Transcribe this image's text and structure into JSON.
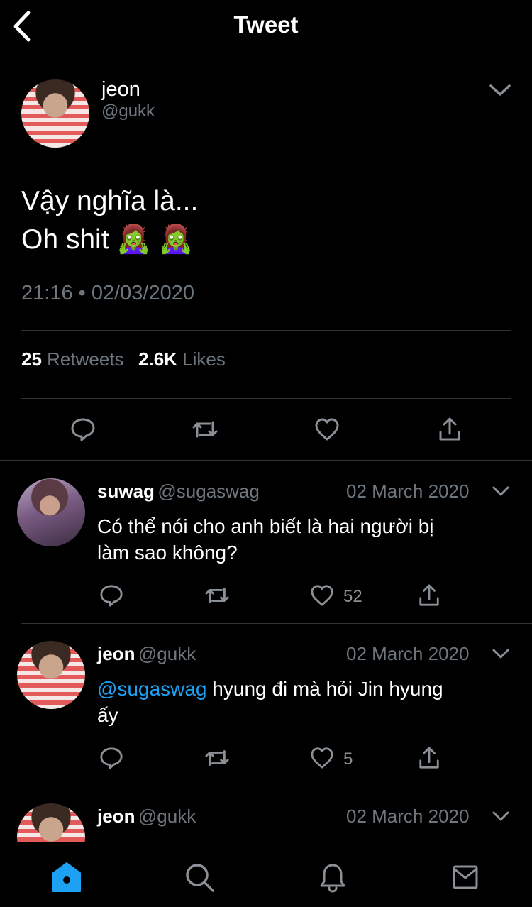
{
  "header": {
    "title": "Tweet"
  },
  "tweet": {
    "name": "jeon",
    "handle": "@gukk",
    "text_line1": "Vậy nghĩa là...",
    "text_line2": "Oh shit 🧟‍♀️ 🧟‍♀️",
    "timestamp": "21:16 • 02/03/2020",
    "retweets_count": "25",
    "retweets_label": "Retweets",
    "likes_count": "2.6K",
    "likes_label": "Likes"
  },
  "replies": [
    {
      "name": "suwag",
      "handle": "@sugaswag",
      "date": "02 March 2020",
      "text_line1": "Có thể nói cho anh biết là hai người bị",
      "text_line2": "làm sao không?",
      "likes": "52"
    },
    {
      "name": "jeon",
      "handle": "@gukk",
      "date": "02 March 2020",
      "mention": "@sugaswag",
      "text_line1": " hyung đi mà hỏi Jin hyung",
      "text_line2": "ấy",
      "likes": "5"
    },
    {
      "name": "jeon",
      "handle": "@gukk",
      "date": "02 March 2020"
    }
  ],
  "colors": {
    "accent": "#1da1f2",
    "muted": "#6e767d",
    "divider": "#2f3336"
  },
  "icons": [
    "back-icon",
    "chevron-down-icon",
    "reply-icon",
    "retweet-icon",
    "like-icon",
    "share-icon",
    "home-icon",
    "search-icon",
    "bell-icon",
    "mail-icon"
  ]
}
